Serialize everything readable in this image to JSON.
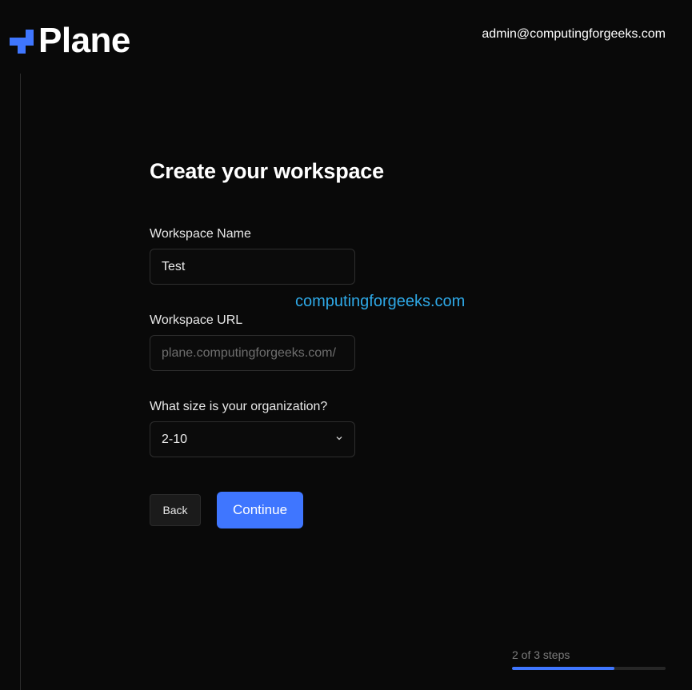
{
  "header": {
    "logo_text": "Plane",
    "user_email": "admin@computingforgeeks.com",
    "brand_color": "#3f76ff"
  },
  "form": {
    "title": "Create your workspace",
    "workspace_name": {
      "label": "Workspace Name",
      "value": "Test"
    },
    "workspace_url": {
      "label": "Workspace URL",
      "prefix": "plane.computingforgeeks.com/"
    },
    "organization_size": {
      "label": "What size is your organization?",
      "selected": "2-10",
      "icon": "chevron-down-icon"
    },
    "back_label": "Back",
    "continue_label": "Continue"
  },
  "watermark": "computingforgeeks.com",
  "progress": {
    "text": "2 of 3 steps",
    "current": 2,
    "total": 3
  }
}
